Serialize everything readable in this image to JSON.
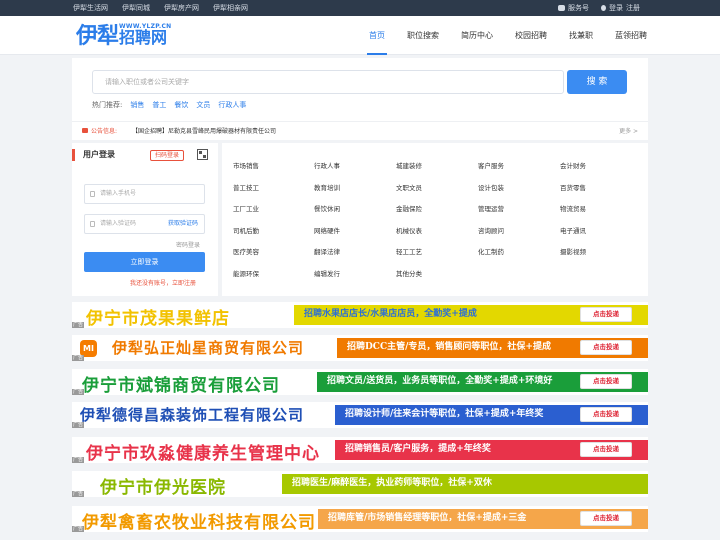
{
  "topbar": {
    "links": [
      "伊犁生活网",
      "伊犁同城",
      "伊犁房产网",
      "伊犁相亲网"
    ],
    "service": "服务号",
    "login": "登录",
    "register": "注册"
  },
  "logo": {
    "main": "伊犁",
    "sub": "招聘网",
    "url": "WWW.YLZP.CN"
  },
  "nav": [
    "首页",
    "职位搜索",
    "简历中心",
    "校园招聘",
    "找兼职",
    "蓝领招聘"
  ],
  "search": {
    "placeholder": "请输入职位或者公司关键字",
    "button": "搜 索",
    "hot_label": "热门推荐:",
    "hot": [
      "销售",
      "普工",
      "餐饮",
      "文员",
      "行政人事"
    ]
  },
  "notice": {
    "label": "公告信息:",
    "text": "【国企招聘】尼勒克县雪峰民用爆破器材有限责任公司",
    "more": "更多 >"
  },
  "login": {
    "title": "用户登录",
    "qr_button": "扫码登录",
    "phone_placeholder": "请输入手机号",
    "code_placeholder": "请输入验证码",
    "code_button": "获取验证码",
    "pwd_link": "密码登录",
    "submit": "立即登录",
    "register": "我还没有账号，立即注册"
  },
  "categories": [
    [
      "市场销售",
      "行政人事",
      "城建装修",
      "客户服务",
      "会计财务"
    ],
    [
      "普工技工",
      "教育培训",
      "文职文员",
      "设计包装",
      "百货零售"
    ],
    [
      "工厂工业",
      "餐饮休闲",
      "金融保险",
      "管理运营",
      "物流贸易"
    ],
    [
      "司机后勤",
      "网络硬件",
      "机械仪表",
      "咨询顾问",
      "电子通讯"
    ],
    [
      "医疗美容",
      "翻译法律",
      "轻工工艺",
      "化工制药",
      "摄影视频"
    ],
    [
      "能源环保",
      "编辑发行",
      "其他分类",
      "",
      ""
    ]
  ],
  "banners": [
    {
      "company": "伊宁市茂果果鲜店",
      "slogan": "招聘水果店店长/水果店店员，全勤奖+提成",
      "button": "点击投递",
      "company_color": "#f2c200",
      "strip_color": "#e3d800",
      "strip_text_color": "#2b6fd6",
      "bg": "#ffffff"
    },
    {
      "company": "伊犁弘正灿星商贸有限公司",
      "slogan": "招聘DCC主管/专员，销售顾问等职位，社保+提成",
      "button": "点击投递",
      "company_color": "#f07a00",
      "strip_color": "#f07a00",
      "strip_text_color": "#ffffff",
      "bg": "#ffffff",
      "logo": "mi"
    },
    {
      "company": "伊宁市斌锦商贸有限公司",
      "slogan": "招聘文员/送货员，业务员等职位，全勤奖+提成+环境好",
      "button": "点击投递",
      "company_color": "#1a9e3a",
      "strip_color": "#1a9e3a",
      "strip_text_color": "#ffffff",
      "bg": "#ffffff"
    },
    {
      "company": "伊犁德得昌森装饰工程有限公司",
      "slogan": "招聘设计师/往来会计等职位，社保+提成+年终奖",
      "button": "点击投递",
      "company_color": "#1f4fb5",
      "strip_color": "#2b5fd0",
      "strip_text_color": "#ffffff",
      "bg": "#ffffff"
    },
    {
      "company": "伊宁市玖淼健康养生管理中心",
      "slogan": "招聘销售员/客户服务，提成+年终奖",
      "button": "点击投递",
      "company_color": "#e8334a",
      "strip_color": "#e8334a",
      "strip_text_color": "#ffffff",
      "bg": "#ffffff"
    },
    {
      "company": "伊宁市伊光医院",
      "slogan": "招聘医生/麻醉医生，执业药师等职位，社保+双休",
      "button": "",
      "company_color": "#8ab800",
      "strip_color": "#a7c800",
      "strip_text_color": "#ffffff",
      "bg": "#ffffff"
    },
    {
      "company": "伊犁禽畜农牧业科技有限公司",
      "slogan": "招聘库管/市场销售经理等职位，社保+提成+三金",
      "button": "点击投递",
      "company_color": "#f29a00",
      "strip_color": "#f5a64a",
      "strip_text_color": "#ffffff",
      "bg": "#ffffff"
    }
  ],
  "ad_label": "广告"
}
